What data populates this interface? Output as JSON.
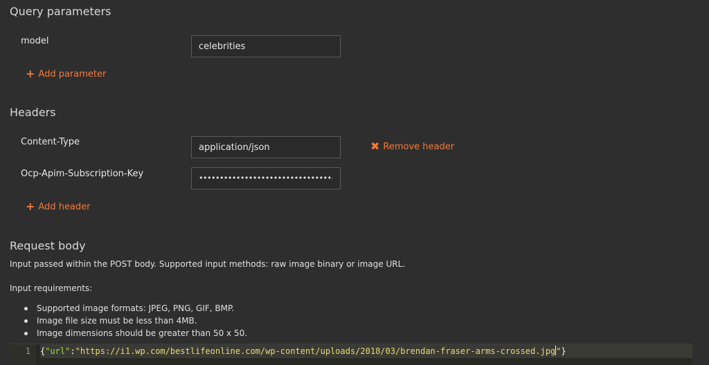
{
  "query_parameters": {
    "title": "Query parameters",
    "params": [
      {
        "label": "model",
        "value": "celebrities"
      }
    ],
    "add_label": "Add parameter"
  },
  "headers": {
    "title": "Headers",
    "items": [
      {
        "label": "Content-Type",
        "value": "application/json"
      },
      {
        "label": "Ocp-Apim-Subscription-Key",
        "value": "••••••••••••••••••••••••••••••••"
      }
    ],
    "remove_label": "Remove header",
    "add_label": "Add header"
  },
  "request_body": {
    "title": "Request body",
    "description": "Input passed within the POST body. Supported input methods: raw image binary or image URL.",
    "requirements_title": "Input requirements:",
    "requirements": [
      "Supported image formats: JPEG, PNG, GIF, BMP.",
      "Image file size must be less than 4MB.",
      "Image dimensions should be greater than 50 x 50."
    ]
  },
  "editor": {
    "line_number": "1",
    "tokens": {
      "open": "{",
      "key": "\"url\"",
      "colon": ":",
      "value": "\"https://i1.wp.com/bestlifeonline.com/wp-content/uploads/2018/03/brendan-fraser-arms-crossed.jpg",
      "close_quote": "\"",
      "close": "}"
    }
  },
  "colors": {
    "background": "#2e2e2e",
    "accent": "#f5793a",
    "field_border": "#5a5a5a",
    "editor_bg": "#272822"
  },
  "icons": {
    "add": "plus-icon",
    "remove": "x-icon",
    "reveal": "eye-icon"
  }
}
